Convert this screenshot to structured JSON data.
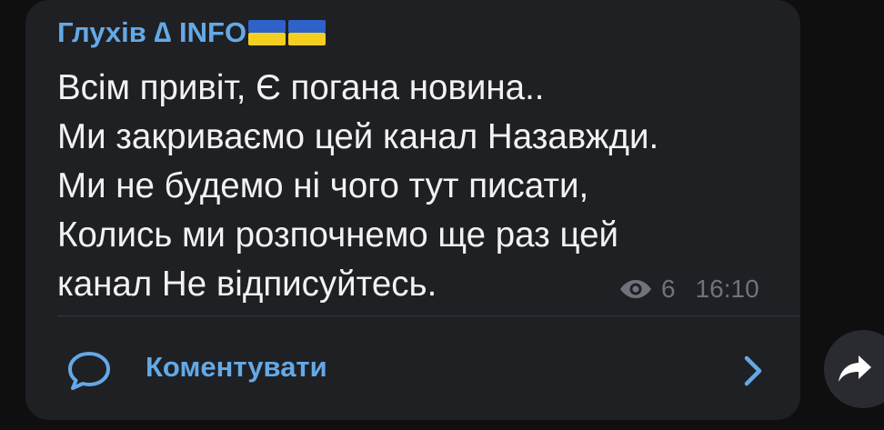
{
  "post": {
    "channel_name": "Глухів ∆ INFO",
    "flag_emojis": "🇺🇦🇺🇦",
    "message": "Всім привіт, Є погана новина..\nМи закриваємо цей канал Назавжди.\nМи не будемо ні чого тут писати,\nКолись ми розпочнемо ще раз цей\nканал Не відписуйтесь.",
    "views": "6",
    "time": "16:10",
    "comments_label": "Коментувати"
  },
  "icons": {
    "views": "eye-icon",
    "comments": "speech-bubble-icon",
    "open_comments": "chevron-right-icon",
    "share": "share-arrow-icon"
  },
  "colors": {
    "bubble": "#1f2024",
    "accent": "#64a9e6",
    "text": "#f2f2f2",
    "meta": "#6f737c",
    "flag_blue": "#2f62c8",
    "flag_yellow": "#f5cf1f"
  }
}
